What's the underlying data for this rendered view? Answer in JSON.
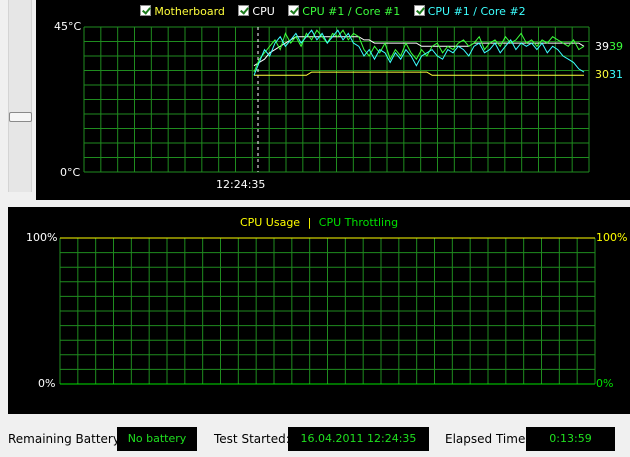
{
  "colors": {
    "grid": "#1f8c1f",
    "motherboard": "#ffff3c",
    "cpu": "#ffffff",
    "core1": "#3cff3c",
    "core2": "#3cffff",
    "usage": "#ffff00",
    "throttling": "#00e000",
    "status_text": "#1fe01f"
  },
  "temperature_chart": {
    "legend": [
      {
        "label": "Motherboard",
        "checked": true,
        "color": "#ffff3c"
      },
      {
        "label": "CPU",
        "checked": true,
        "color": "#ffffff"
      },
      {
        "label": "CPU #1 / Core #1",
        "checked": true,
        "color": "#3cff3c"
      },
      {
        "label": "CPU #1 / Core #2",
        "checked": true,
        "color": "#3cffff"
      }
    ],
    "y_max_label": "45°C",
    "y_min_label": "0°C",
    "x_marker_label": "12:24:35",
    "end_values": [
      {
        "text": "39",
        "color": "#ffffff"
      },
      {
        "text": "39",
        "color": "#3cff3c"
      },
      {
        "text": "30",
        "color": "#ffff3c"
      },
      {
        "text": "31",
        "color": "#3cffff"
      }
    ]
  },
  "usage_chart": {
    "legend_usage": "CPU Usage",
    "legend_separator": "|",
    "legend_throttling": "CPU Throttling",
    "left_top": "100%",
    "left_bottom": "0%",
    "right_top": "100%",
    "right_bottom": "0%"
  },
  "status": {
    "battery_label": "Remaining Battery:",
    "battery_value": "No battery",
    "started_label": "Test Started:",
    "started_value": "16.04.2011 12:24:35",
    "elapsed_label": "Elapsed Time:",
    "elapsed_value": "0:13:59"
  },
  "chart_data": [
    {
      "type": "line",
      "title": "",
      "ylim": [
        0,
        45
      ],
      "x_ticks": [
        "12:24:35"
      ],
      "series": [
        {
          "name": "Motherboard",
          "values": [
            30,
            30,
            30,
            30,
            30,
            30,
            30,
            30,
            30,
            30,
            30,
            31,
            31,
            31,
            31,
            31,
            31,
            31,
            31,
            31,
            31,
            31,
            31,
            31,
            31,
            31,
            31,
            31,
            31,
            31,
            31,
            31,
            31,
            31,
            30,
            30,
            30,
            30,
            30,
            30,
            30,
            30,
            30,
            30,
            30,
            30,
            30,
            30,
            30,
            30,
            30,
            30,
            30,
            30,
            30,
            30,
            30,
            30,
            30,
            30,
            30,
            30,
            30,
            30
          ]
        },
        {
          "name": "CPU",
          "values": [
            33,
            34,
            35,
            37,
            38,
            39,
            40,
            41,
            42,
            42,
            42,
            42,
            42,
            42,
            42,
            42,
            42,
            42,
            42,
            42,
            42,
            41,
            41,
            40,
            40,
            40,
            40,
            40,
            40,
            40,
            40,
            40,
            39,
            39,
            39,
            39,
            39,
            39,
            39,
            39,
            39,
            39,
            40,
            40,
            40,
            40,
            40,
            40,
            40,
            40,
            40,
            40,
            40,
            40,
            40,
            40,
            40,
            40,
            40,
            40,
            40,
            40,
            40,
            39
          ]
        },
        {
          "name": "CPU #1 / Core #1",
          "values": [
            31,
            35,
            37,
            39,
            41,
            38,
            43,
            40,
            42,
            39,
            43,
            41,
            44,
            42,
            40,
            43,
            42,
            44,
            41,
            43,
            42,
            38,
            36,
            39,
            37,
            40,
            35,
            38,
            36,
            40,
            37,
            35,
            38,
            36,
            39,
            40,
            37,
            39,
            38,
            40,
            41,
            39,
            40,
            42,
            38,
            40,
            41,
            39,
            42,
            40,
            41,
            43,
            40,
            41,
            39,
            41,
            40,
            42,
            41,
            40,
            39,
            41,
            38,
            39
          ]
        },
        {
          "name": "CPU #1 / Core #2",
          "values": [
            30,
            34,
            38,
            36,
            40,
            42,
            39,
            41,
            43,
            40,
            42,
            44,
            41,
            43,
            40,
            42,
            44,
            41,
            43,
            40,
            39,
            36,
            38,
            35,
            38,
            37,
            34,
            37,
            35,
            38,
            36,
            33,
            36,
            37,
            38,
            36,
            35,
            38,
            37,
            39,
            38,
            36,
            39,
            40,
            37,
            38,
            40,
            37,
            39,
            41,
            38,
            40,
            39,
            40,
            38,
            40,
            37,
            39,
            38,
            36,
            35,
            34,
            32,
            31
          ]
        }
      ]
    },
    {
      "type": "line",
      "title": "",
      "ylim": [
        0,
        100
      ],
      "series": [
        {
          "name": "CPU Usage",
          "values": [
            100
          ]
        },
        {
          "name": "CPU Throttling",
          "values": [
            0
          ]
        }
      ]
    }
  ]
}
